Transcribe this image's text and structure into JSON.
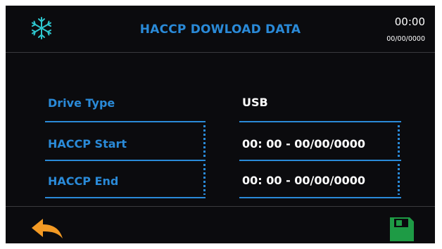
{
  "header": {
    "title": "HACCP DOWLOAD DATA",
    "time": "00:00",
    "date": "00/00/0000",
    "icon": "snowflake-icon"
  },
  "rows": [
    {
      "label": "Drive Type",
      "value": "USB"
    },
    {
      "label": "HACCP Start",
      "value": "00: 00 - 00/00/0000"
    },
    {
      "label": "HACCP End",
      "value": "00: 00 - 00/00/0000"
    }
  ],
  "footer": {
    "back_icon": "back-arrow-icon",
    "save_icon": "save-icon"
  },
  "colors": {
    "background": "#0b0b0e",
    "accent": "#2a8ad8",
    "icon_cyan": "#2ec7cf",
    "back_orange": "#f39a24",
    "save_green": "#1e9b45"
  }
}
